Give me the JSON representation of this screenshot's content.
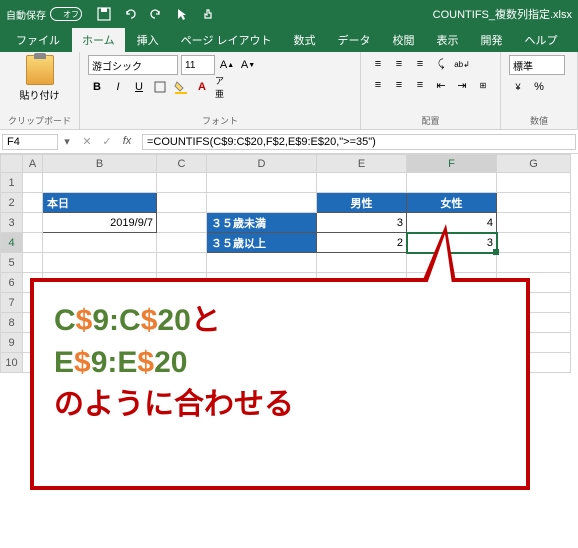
{
  "title": "COUNTIFS_複数列指定.xlsx",
  "autosave_label": "自動保存",
  "autosave_state": "オフ",
  "tabs": [
    "ファイル",
    "ホーム",
    "挿入",
    "ページ レイアウト",
    "数式",
    "データ",
    "校閲",
    "表示",
    "開発",
    "ヘルプ"
  ],
  "active_tab": 1,
  "ribbon": {
    "clipboard_label": "クリップボード",
    "paste_label": "貼り付け",
    "font_label": "フォント",
    "font_name": "游ゴシック",
    "font_size": "11",
    "alignment_label": "配置",
    "number_label": "数値",
    "number_format": "標準"
  },
  "namebox": "F4",
  "formula": "=COUNTIFS(C$9:C$20,F$2,E$9:E$20,\">=35\")",
  "columns": [
    "A",
    "B",
    "C",
    "D",
    "E",
    "F",
    "G"
  ],
  "rows": [
    "1",
    "2",
    "3",
    "4",
    "5",
    "6",
    "7",
    "8",
    "9",
    "10"
  ],
  "cells": {
    "B2": "本日",
    "B3": "2019/9/7",
    "E2": "男性",
    "F2": "女性",
    "D3": "３５歳未満",
    "D4": "３５歳以上",
    "E3": "3",
    "E4": "2",
    "F3": "4",
    "F4": "3"
  },
  "callout": {
    "l1a": "C",
    "l1b": "$",
    "l1c": "9:C",
    "l1d": "$",
    "l1e": "20",
    "l1f": "と",
    "l2a": "E",
    "l2b": "$",
    "l2c": "9:E",
    "l2d": "$",
    "l2e": "20",
    "l3": "のように合わせる"
  }
}
